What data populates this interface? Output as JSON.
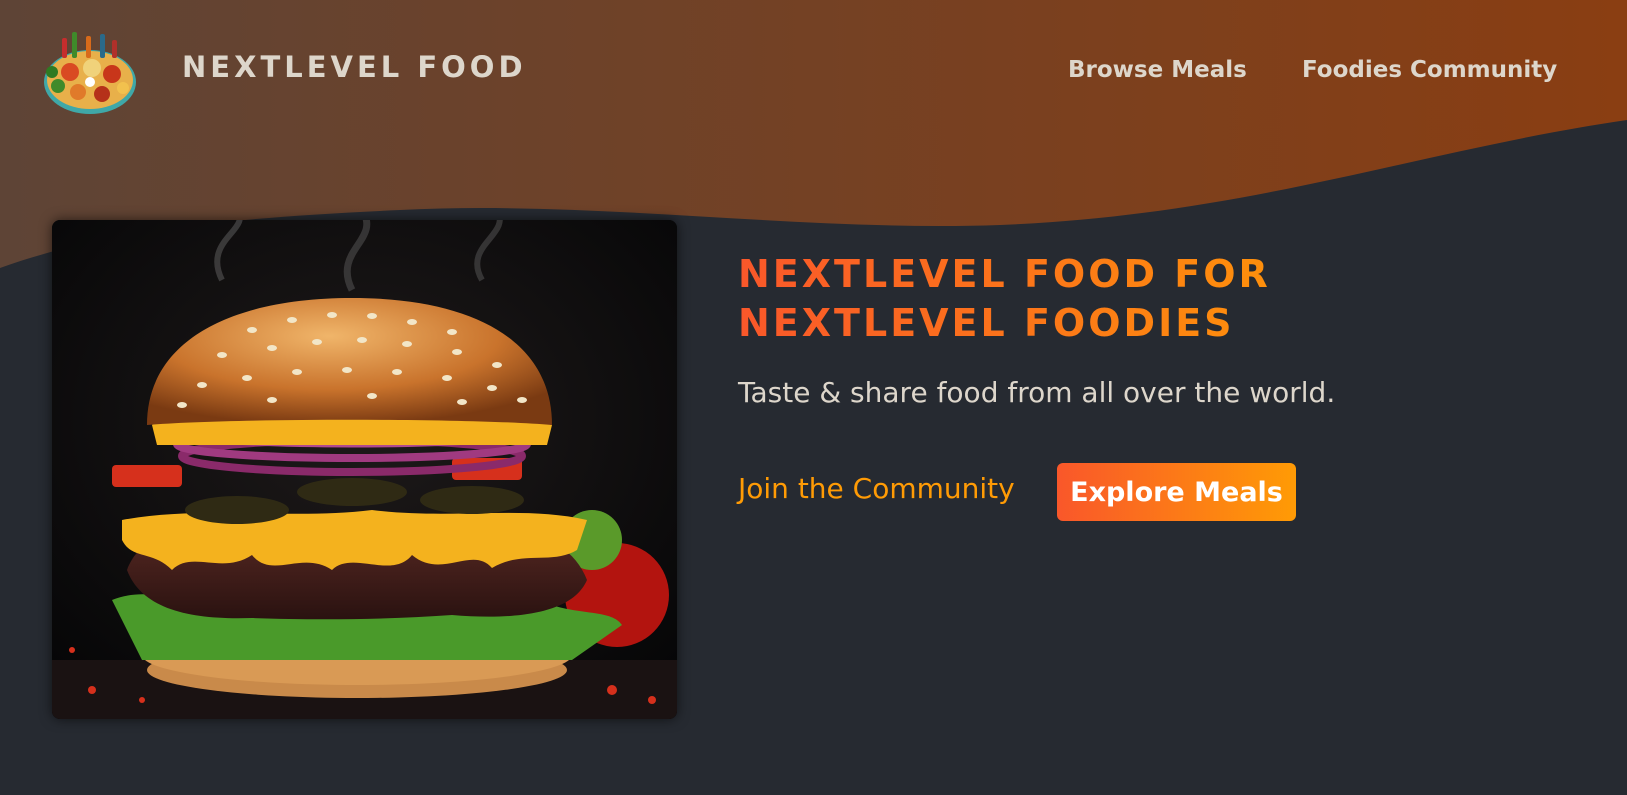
{
  "header": {
    "brand": "NEXTLEVEL FOOD",
    "nav": {
      "browse_meals": "Browse Meals",
      "foodies_community": "Foodies Community"
    }
  },
  "hero": {
    "title_line1": "NEXTLEVEL FOOD FOR",
    "title_line2": "NEXTLEVEL FOODIES",
    "subtitle": "Taste & share food from all over the world.",
    "cta_secondary": "Join the Community",
    "cta_primary": "Explore Meals",
    "image": "burger-image"
  },
  "colors": {
    "background": "#262a31",
    "header_gradient_start": "#5e4436",
    "header_gradient_end": "#8a3e12",
    "accent_start": "#f9572a",
    "accent_end": "#ff9b05",
    "text_light": "#ddd6cb"
  }
}
